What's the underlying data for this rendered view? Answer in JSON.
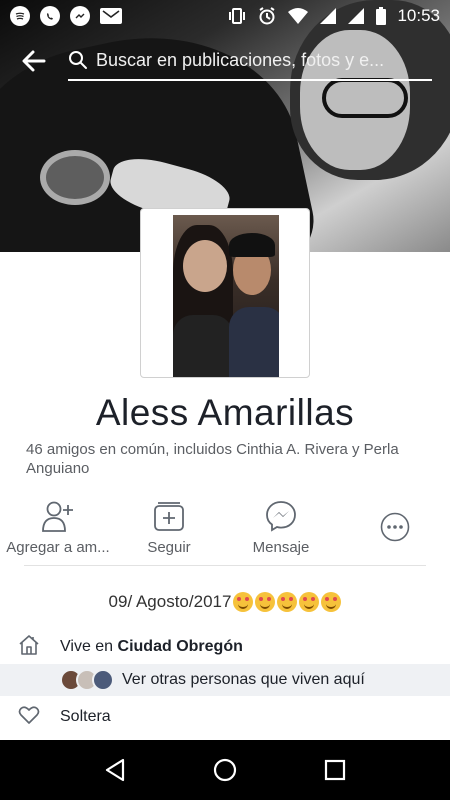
{
  "status_bar": {
    "time": "10:53",
    "left_icons": [
      "spotify-icon",
      "whatsapp-icon",
      "messenger-icon",
      "gmail-icon"
    ],
    "right_icons": [
      "vibrate-icon",
      "alarm-icon",
      "wifi-icon",
      "signal-icon",
      "signal-icon",
      "battery-icon"
    ]
  },
  "top_bar": {
    "search_placeholder": "Buscar en publicaciones, fotos y e..."
  },
  "profile": {
    "name": "Aless Amarillas",
    "mutual_friends": "46 amigos en común, incluidos Cinthia A. Rivera y Perla Anguiano"
  },
  "actions": {
    "add_friend": "Agregar a am...",
    "follow": "Seguir",
    "message": "Mensaje"
  },
  "bio": {
    "text": "09/ Agosto/2017",
    "emoji_count": 5
  },
  "info": {
    "lives_prefix": "Vive en ",
    "lives_city": "Ciudad Obregón",
    "see_others": "Ver otras personas que viven aquí",
    "relationship": "Soltera"
  },
  "colors": {
    "text_primary": "#1d2129",
    "text_secondary": "#5b5e63",
    "icon_gray": "#606770",
    "highlight_row": "#eff1f4"
  }
}
